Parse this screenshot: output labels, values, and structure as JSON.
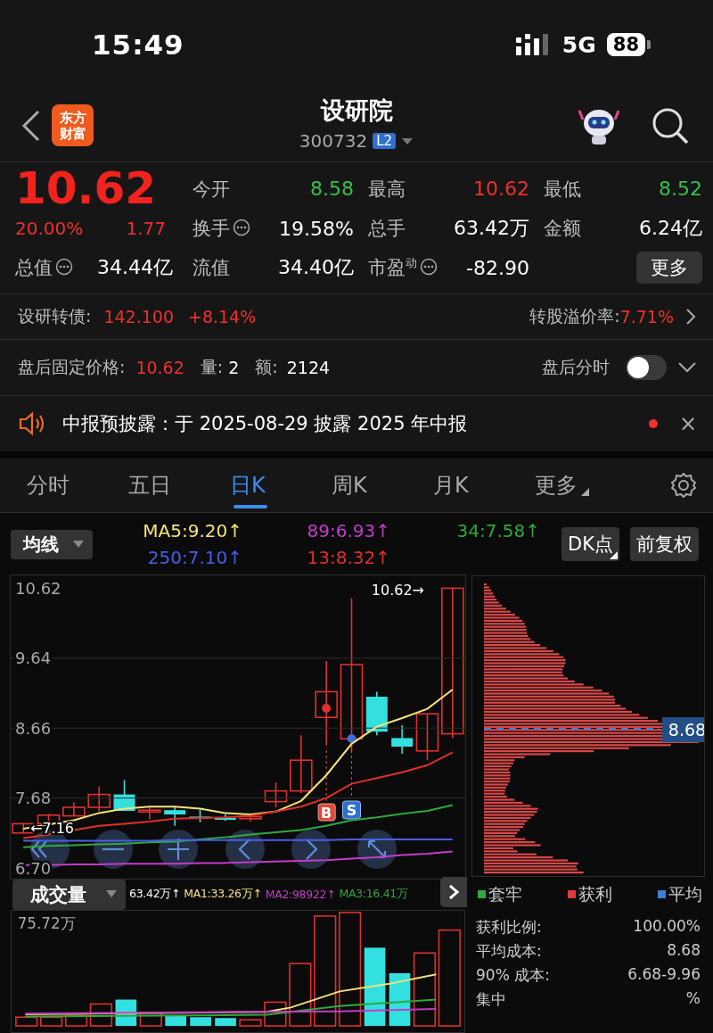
{
  "status_bar": {
    "time": "15:49",
    "network": "5G",
    "battery": "88"
  },
  "header": {
    "logo_lines": [
      "东方",
      "财富"
    ],
    "title": "设研院",
    "code": "300732",
    "badge": "L2"
  },
  "quote": {
    "price": "10.62",
    "change_pct": "20.00%",
    "change": "1.77",
    "total_value": {
      "label": "总值",
      "value": "34.44亿",
      "has_info": true
    },
    "fields": [
      {
        "label": "今开",
        "value": "8.58",
        "color": "#33c24a",
        "has_info": false
      },
      {
        "label": "最高",
        "value": "10.62",
        "color": "#f0302c",
        "has_info": false
      },
      {
        "label": "最低",
        "value": "8.52",
        "color": "#33c24a",
        "has_info": false
      },
      {
        "label": "换手",
        "value": "19.58%",
        "color": "#ffffff",
        "has_info": true
      },
      {
        "label": "总手",
        "value": "63.42万",
        "color": "#ffffff",
        "has_info": false
      },
      {
        "label": "金额",
        "value": "6.24亿",
        "color": "#ffffff",
        "has_info": false
      },
      {
        "label": "流值",
        "value": "34.40亿",
        "color": "#ffffff",
        "has_info": false
      },
      {
        "label": "市盈$^{动}$",
        "value": "-82.90",
        "color": "#ffffff",
        "has_info": true
      }
    ],
    "more_button": "更多"
  },
  "bond": {
    "label": "设研转债:",
    "price": "142.100",
    "change": "+8.14%",
    "premium_label": "转股溢价率:",
    "premium": "7.71%"
  },
  "after_hours": {
    "label": "盘后固定价格:",
    "price": "10.62",
    "volume_label": "量:",
    "volume": "2",
    "amount_label": "额:",
    "amount": "2124",
    "chart_label": "盘后分时",
    "toggle_on": false
  },
  "notice": {
    "text": "中报预披露：于 2025-08-29 披露 2025 年中报",
    "unread": true,
    "close": "×"
  },
  "tabs": [
    {
      "label": "分时",
      "selected": false
    },
    {
      "label": "五日",
      "selected": false
    },
    {
      "label": "日K",
      "selected": true
    },
    {
      "label": "周K",
      "selected": false
    },
    {
      "label": "月K",
      "selected": false
    },
    {
      "label": "更多",
      "selected": false
    }
  ],
  "indicators": {
    "selector": "均线",
    "ma": [
      {
        "label": "MA5:9.20↑",
        "color": "#f5e27a"
      },
      {
        "label": "89:6.93↑",
        "color": "#c23cc8"
      },
      {
        "label": "34:7.58↑",
        "color": "#2fa83a"
      },
      {
        "label": "250:7.10↑",
        "color": "#4a5ee6"
      },
      {
        "label": "13:8.32↑",
        "color": "#e0302a"
      }
    ],
    "dk_button": "DK点",
    "adjust_button": "前复权"
  },
  "kline": {
    "last_label": "10.62→",
    "low_label": "←7.16",
    "buy_marker": "B",
    "sell_marker": "S",
    "chart_data": {
      "type": "line",
      "grid": true,
      "ylim": [
        6.55,
        10.8
      ],
      "yticks": [
        {
          "value": 10.62,
          "label": "10.62"
        },
        {
          "value": 9.64,
          "label": "9.64"
        },
        {
          "value": 8.66,
          "label": "8.66"
        },
        {
          "value": 7.68,
          "label": "7.68"
        },
        {
          "value": 6.7,
          "label": "6.70"
        }
      ],
      "series": [
        {
          "color": "#f5e27a",
          "values": [
            7.25,
            7.31,
            7.37,
            7.47,
            7.53,
            7.56,
            7.56,
            7.53,
            7.47,
            7.45,
            7.49,
            7.64,
            8.0,
            8.44,
            8.68,
            8.8,
            8.93,
            9.2
          ]
        },
        {
          "color": "#e0302a",
          "values": [
            7.12,
            7.17,
            7.23,
            7.29,
            7.32,
            7.35,
            7.39,
            7.4,
            7.41,
            7.43,
            7.49,
            7.56,
            7.68,
            7.88,
            7.96,
            8.04,
            8.14,
            8.32
          ]
        },
        {
          "color": "#2fa83a",
          "values": [
            6.99,
            7.01,
            7.02,
            7.03,
            7.04,
            7.06,
            7.07,
            7.1,
            7.13,
            7.17,
            7.2,
            7.23,
            7.29,
            7.37,
            7.41,
            7.46,
            7.5,
            7.58
          ]
        },
        {
          "color": "#4a5ee6",
          "values": [
            7.08,
            7.08,
            7.08,
            7.08,
            7.08,
            7.08,
            7.09,
            7.09,
            7.09,
            7.09,
            7.09,
            7.09,
            7.09,
            7.1,
            7.1,
            7.1,
            7.1,
            7.1
          ]
        },
        {
          "color": "#c23cc8",
          "values": [
            6.74,
            6.74,
            6.75,
            6.75,
            6.76,
            6.76,
            6.76,
            6.77,
            6.77,
            6.78,
            6.79,
            6.8,
            6.81,
            6.83,
            6.85,
            6.88,
            6.9,
            6.93
          ]
        }
      ]
    }
  },
  "chips": {
    "avg_label": "8.68",
    "legend": [
      {
        "label": "套牢",
        "color": "#2fa83a"
      },
      {
        "label": "获利",
        "color": "#e03a3a"
      },
      {
        "label": "平均",
        "color": "#3d7ed8"
      }
    ],
    "stats": [
      {
        "label": "获利比例:",
        "value": "100.00%"
      },
      {
        "label": "平均成本:",
        "value": "8.68"
      },
      {
        "label": "90% 成本:",
        "value": "6.68-9.96"
      },
      {
        "label": "集中",
        "value": "%"
      }
    ]
  },
  "volume": {
    "selector": "成交量",
    "legend": [
      {
        "label": "63.42万↑",
        "color": "#ffffff"
      },
      {
        "label": "MA1:33.26万↑",
        "color": "#f5e27a"
      },
      {
        "label": "MA2:98922↑",
        "color": "#c23cc8"
      },
      {
        "label": "MA3:16.41万",
        "color": "#2fa83a"
      }
    ],
    "max_label": "75.72万"
  }
}
